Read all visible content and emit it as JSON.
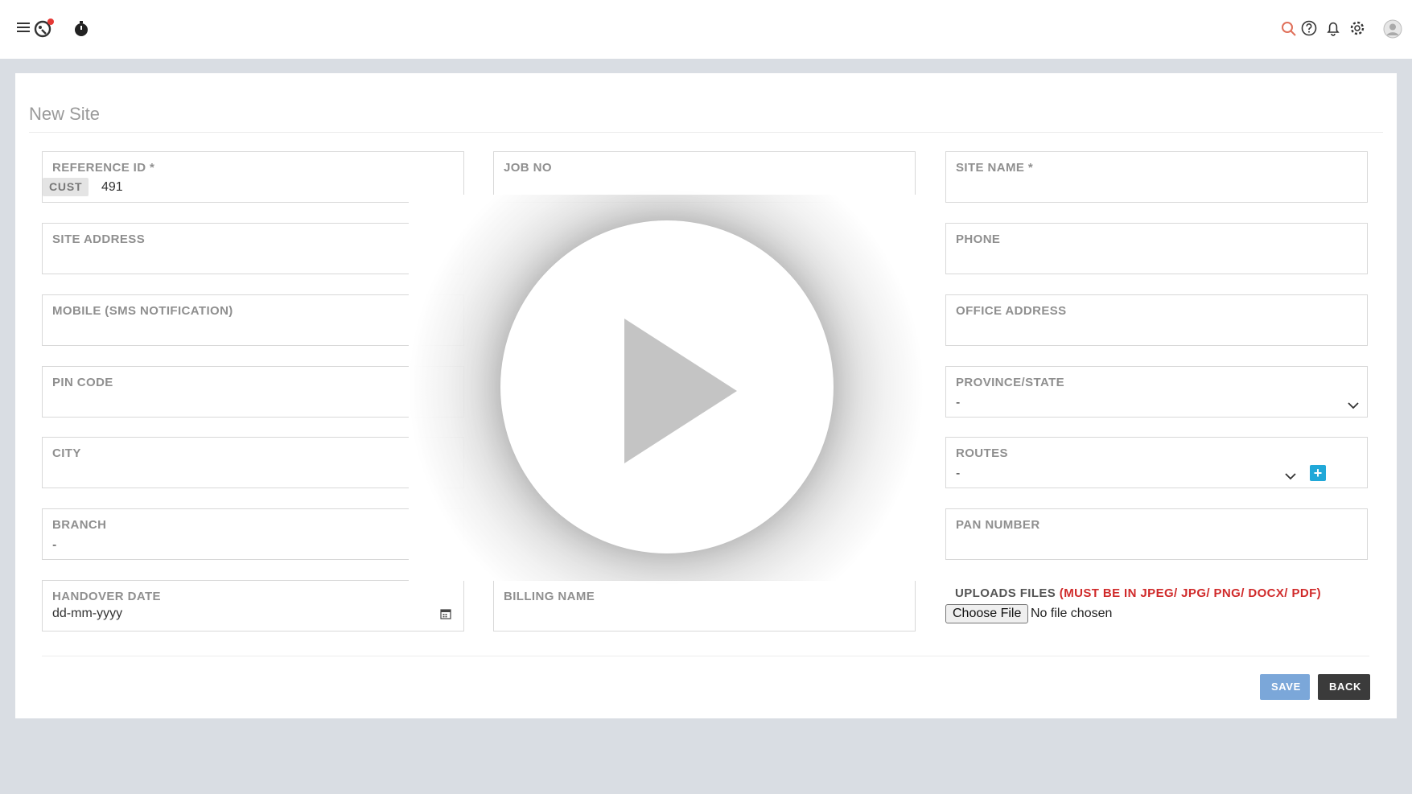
{
  "topbar": {
    "icons": [
      "menu-icon",
      "logo-icon",
      "timer-icon",
      "search-icon",
      "help-icon",
      "bell-icon",
      "gear-icon",
      "avatar-icon"
    ],
    "accent": "#e0705a",
    "notification_color": "#e53935"
  },
  "page": {
    "title": "New Site"
  },
  "form": {
    "reference_id": {
      "label": "REFERENCE ID *",
      "prefix": "CUST",
      "value": "491"
    },
    "job_no": {
      "label": "JOB NO",
      "value": ""
    },
    "site_name": {
      "label": "SITE NAME *",
      "value": ""
    },
    "site_address": {
      "label": "SITE ADDRESS",
      "value": ""
    },
    "phone": {
      "label": "PHONE",
      "value": ""
    },
    "mobile": {
      "label": "MOBILE (SMS NOTIFICATION)",
      "value": ""
    },
    "office_address": {
      "label": "OFFICE ADDRESS",
      "value": ""
    },
    "pin_code": {
      "label": "PIN CODE",
      "value": ""
    },
    "province_state": {
      "label": "PROVINCE/STATE",
      "value": "-"
    },
    "city": {
      "label": "CITY",
      "value": ""
    },
    "routes": {
      "label": "ROUTES",
      "value": "-"
    },
    "branch": {
      "label": "BRANCH",
      "value": "-"
    },
    "pan_number": {
      "label": "PAN NUMBER",
      "value": ""
    },
    "handover_date": {
      "label": "HANDOVER DATE",
      "placeholder": "dd-mm-yyyy"
    },
    "billing_name": {
      "label": "BILLING NAME",
      "value": ""
    },
    "uploads": {
      "label": "UPLOADS FILES",
      "warning": "(MUST BE IN JPEG/ JPG/ PNG/ DOCX/ PDF)",
      "button": "Choose File",
      "status": "No file chosen"
    }
  },
  "actions": {
    "save": "SAVE",
    "back": "BACK",
    "save_color": "#7ba7d9",
    "back_color": "#3b3b3b"
  },
  "overlay": {
    "icon": "play-icon"
  }
}
